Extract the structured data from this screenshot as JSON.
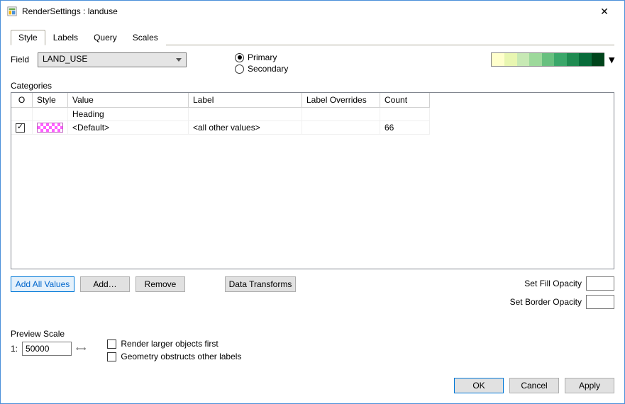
{
  "window": {
    "title": "RenderSettings : landuse"
  },
  "tabs": {
    "style": "Style",
    "labels": "Labels",
    "query": "Query",
    "scales": "Scales"
  },
  "field": {
    "label": "Field",
    "value": "LAND_USE"
  },
  "radio": {
    "primary": "Primary",
    "secondary": "Secondary"
  },
  "ramp": {
    "colors": [
      "#ffffcc",
      "#e8f6b1",
      "#c7e9b4",
      "#9dd99b",
      "#68c07f",
      "#3ba76a",
      "#1f8b51",
      "#086b3a",
      "#00441b"
    ]
  },
  "categories": {
    "sectionLabel": "Categories",
    "headers": {
      "on": "O",
      "style": "Style",
      "value": "Value",
      "label": "Label",
      "overrides": "Label Overrides",
      "count": "Count"
    },
    "headingRow": "Heading",
    "defaultRow": {
      "value": "<Default>",
      "label": "<all other values>",
      "count": "66"
    }
  },
  "buttons": {
    "addAll": "Add All Values",
    "add": "Add…",
    "remove": "Remove",
    "transforms": "Data Transforms",
    "ok": "OK",
    "cancel": "Cancel",
    "apply": "Apply"
  },
  "opacity": {
    "fill": "Set Fill Opacity",
    "border": "Set Border Opacity"
  },
  "preview": {
    "label": "Preview Scale",
    "prefix": "1:",
    "value": "50000"
  },
  "renderOpts": {
    "larger": "Render larger objects first",
    "obstruct": "Geometry obstructs other labels"
  }
}
